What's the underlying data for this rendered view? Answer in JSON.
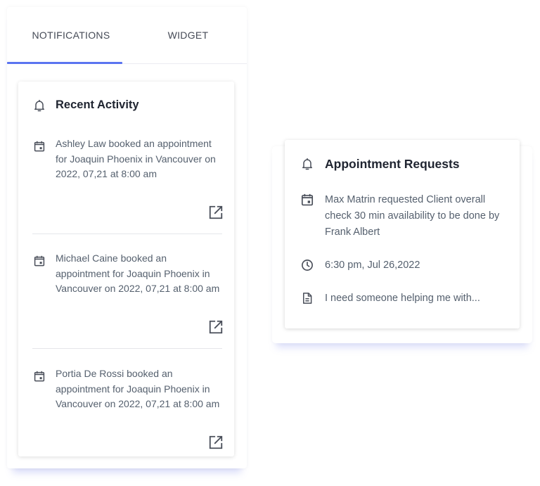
{
  "tabs": [
    {
      "label": "NOTIFICATIONS"
    },
    {
      "label": "WIDGET"
    }
  ],
  "recent_activity": {
    "title": "Recent Activity",
    "items": [
      {
        "text": "Ashley Law booked an appointment for Joaquin Phoenix in Vancouver on 2022, 07,21 at 8:00 am"
      },
      {
        "text": "Michael Caine booked an appointment for Joaquin Phoenix in Vancouver on 2022, 07,21 at 8:00 am"
      },
      {
        "text": "Portia De Rossi booked an appointment for Joaquin Phoenix in Vancouver on 2022, 07,21 at 8:00 am"
      }
    ]
  },
  "appointment_requests": {
    "title": "Appointment Requests",
    "request": "Max Matrin requested Client overall check 30 min availability to be done by Frank Albert",
    "time": "6:30 pm, Jul 26,2022",
    "note": "I need someone helping me with..."
  },
  "icons": {
    "bell": "bell-icon",
    "calendar": "calendar-icon",
    "open_external": "open-external-icon",
    "clock": "clock-icon",
    "document": "document-icon"
  },
  "colors": {
    "accent": "#5b74f0",
    "icon": "#4a4f5a",
    "title": "#1f2430",
    "body_text": "#55606e"
  }
}
